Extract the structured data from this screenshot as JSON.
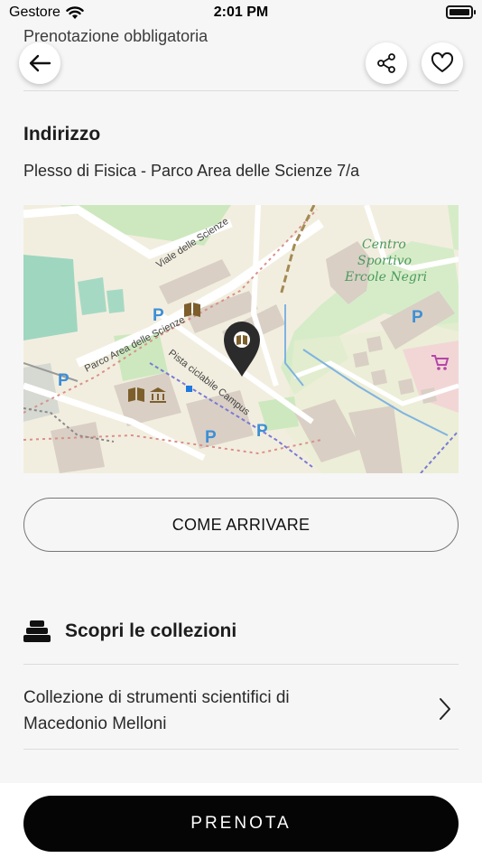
{
  "status_bar": {
    "carrier": "Gestore",
    "time": "2:01 PM"
  },
  "header": {
    "previous_line": "Prenotazione obbligatoria",
    "icons": [
      "back-arrow-icon",
      "share-icon",
      "heart-icon"
    ]
  },
  "address": {
    "heading": "Indirizzo",
    "text": "Plesso di Fisica - Parco Area delle Scienze 7/a"
  },
  "map": {
    "street_labels": [
      "Viale delle Scienze",
      "Parco Area delle Scienze",
      "Pista ciclabile Campus"
    ],
    "poi_label_lines": [
      "Centro",
      "Sportivo",
      "Ercole Negri"
    ],
    "parking_label": "P",
    "icons": [
      "map-pin-icon",
      "library-icon",
      "museum-icon",
      "shopping-cart-icon"
    ]
  },
  "directions": {
    "label": "COME ARRIVARE"
  },
  "collections": {
    "heading": "Scopri le collezioni",
    "items": [
      {
        "line1": "Collezione di strumenti scientifici di",
        "line2": "Macedonio Melloni"
      }
    ]
  },
  "cta": {
    "label": "PRENOTA"
  },
  "colors": {
    "map_background": "#f2eedf",
    "map_green": "#cde8be",
    "map_building": "#d9cfc5",
    "map_parking_blue": "#3d8fd6",
    "cta_background": "#050505"
  }
}
